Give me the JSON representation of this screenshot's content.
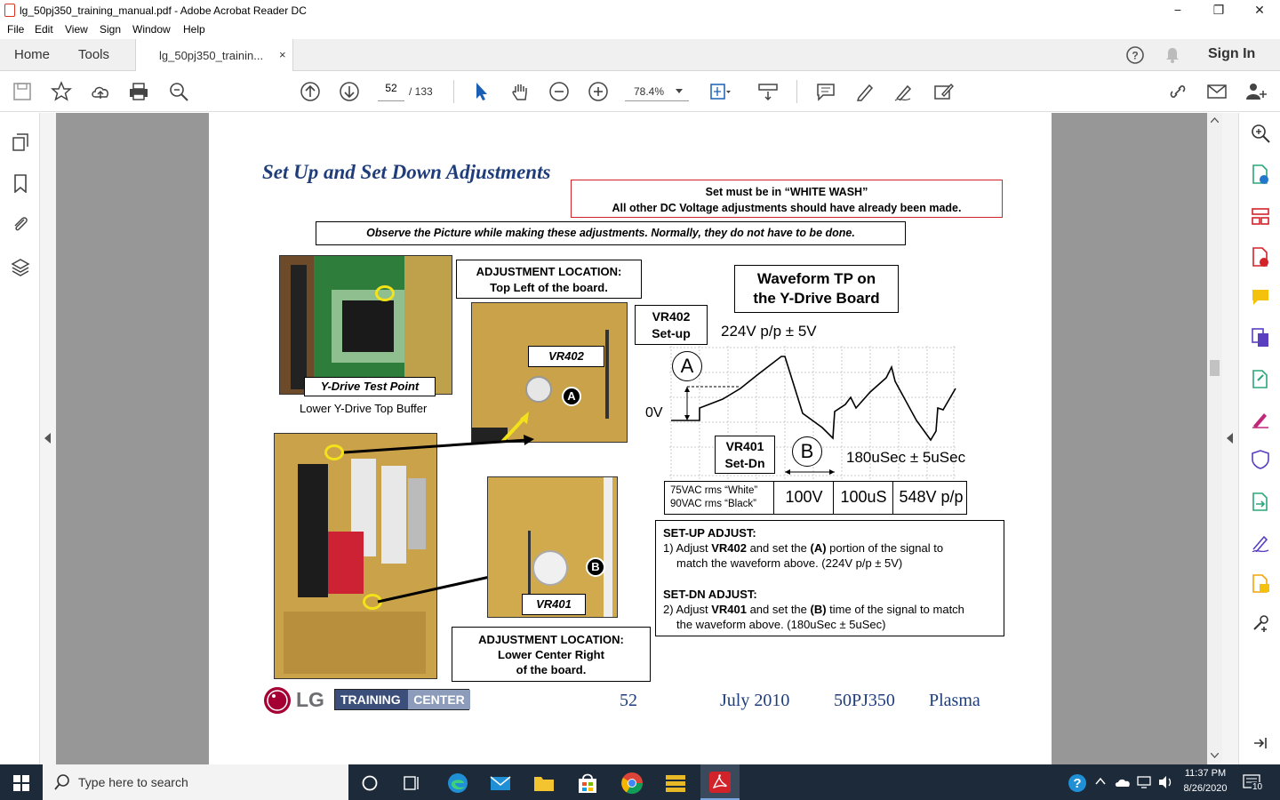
{
  "window": {
    "title": "lg_50pj350_training_manual.pdf - Adobe Acrobat Reader DC",
    "minimize": "−",
    "maximize": "❐",
    "close": "✕"
  },
  "menu": [
    "File",
    "Edit",
    "View",
    "Sign",
    "Window",
    "Help"
  ],
  "tabs": {
    "home": "Home",
    "tools": "Tools",
    "document": "lg_50pj350_trainin...",
    "close": "×",
    "sign_in": "Sign In"
  },
  "toolbar": {
    "page_current": "52",
    "page_total": "/ 133",
    "zoom": "78.4%"
  },
  "page": {
    "heading": "Set Up and Set Down Adjustments",
    "warning_line1": "Set must be in “WHITE WASH”",
    "warning_line2": "All other DC Voltage adjustments should have already been made.",
    "observe": "Observe the Picture while making these adjustments. Normally, they do not have to be done.",
    "adj_loc_top_line1": "ADJUSTMENT LOCATION:",
    "adj_loc_top_line2": "Top Left of the board.",
    "waveform_title_line1": "Waveform TP on",
    "waveform_title_line2": "the Y-Drive Board",
    "vr402_box_line1": "VR402",
    "vr402_box_line2": "Set-up",
    "setup_voltage": "224V p/p ± 5V",
    "ytp_label": "Y-Drive Test Point",
    "ytp_caption": "Lower Y-Drive Top Buffer",
    "vr402_tag": "VR402",
    "vr401_tag": "VR401",
    "marker_a": "A",
    "marker_b": "B",
    "zero_v": "0V",
    "vr401_box_line1": "VR401",
    "vr401_box_line2": "Set-Dn",
    "setdn_time": "180uSec  ± 5uSec",
    "scope_cell1_line1": "75VAC rms “White”",
    "scope_cell1_line2": "90VAC rms “Black”",
    "scope_cell2": "100V",
    "scope_cell3": "100uS",
    "scope_cell4": "548V p/p",
    "setup_heading": "SET-UP ADJUST:",
    "setup_step_pre": "1) Adjust ",
    "setup_step_vr": "VR402",
    "setup_step_mid": " and set the ",
    "setup_step_a": "(A)",
    "setup_step_post": " portion of the signal to",
    "setup_step_line2": "match the waveform above. (224V p/p ± 5V)",
    "setdn_heading": "SET-DN ADJUST:",
    "setdn_step_pre": "2) Adjust ",
    "setdn_step_vr": "VR401",
    "setdn_step_mid": " and set the ",
    "setdn_step_b": "(B)",
    "setdn_step_post": " time of the signal to match",
    "setdn_step_line2": "the waveform above. (180uSec ± 5uSec)",
    "adj_loc_bottom_line1": "ADJUSTMENT LOCATION:",
    "adj_loc_bottom_line2": "Lower Center Right",
    "adj_loc_bottom_line3": "of the board.",
    "logo_lg": "LG",
    "logo_training": "TRAINING",
    "logo_center": "CENTER",
    "footer_page": "52",
    "footer_date": "July 2010",
    "footer_model": "50PJ350",
    "footer_type": "Plasma"
  },
  "taskbar": {
    "search_placeholder": "Type here to search",
    "time": "11:37 PM",
    "date": "8/26/2020",
    "notifications": "10"
  },
  "colors": {
    "heading_blue": "#1f3d7a",
    "warning_red": "#d2232a",
    "board_green": "#2e7d3a",
    "board_tan": "#c9a24a",
    "taskbar": "#1c2a3a"
  }
}
